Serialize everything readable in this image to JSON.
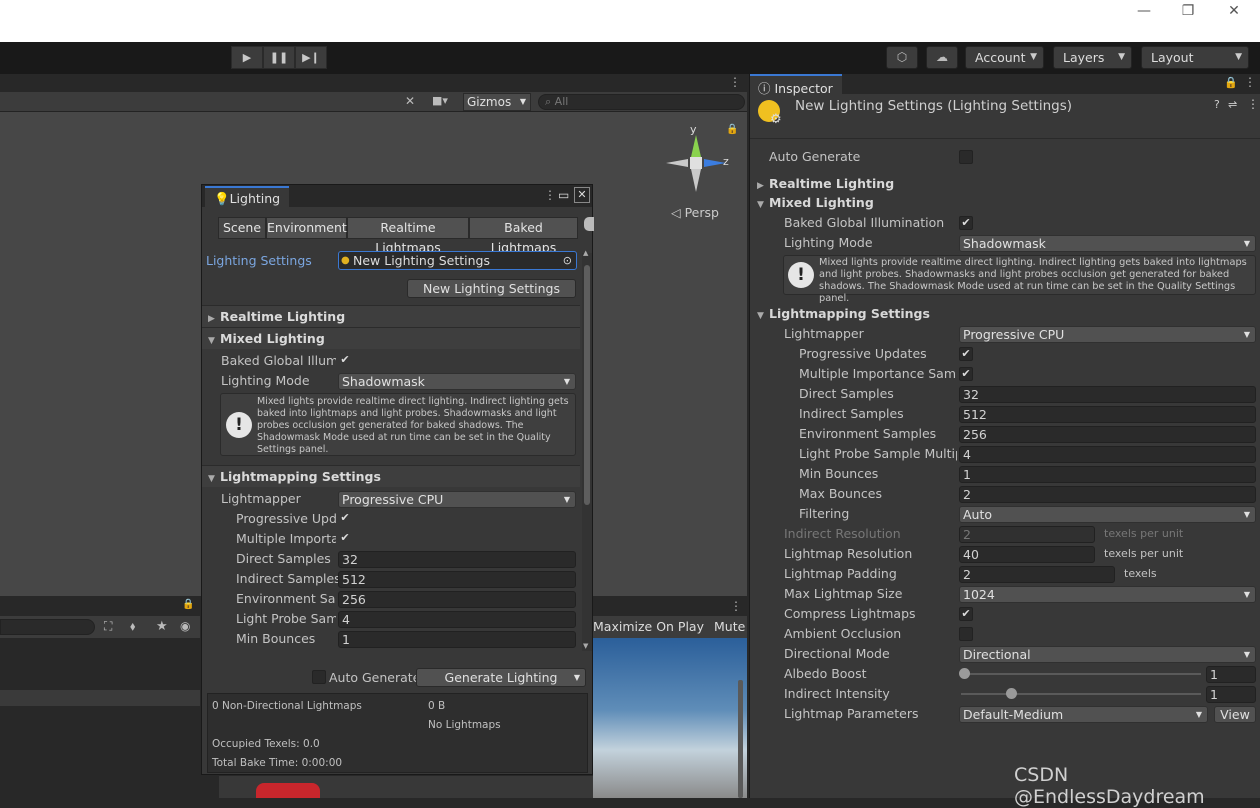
{
  "window": {
    "minimize": "—",
    "restore": "❐",
    "close": "✕"
  },
  "toolbar": {
    "account": "Account",
    "layers": "Layers",
    "layout": "Layout"
  },
  "scene": {
    "gizmos": "Gizmos",
    "search_placeholder": "All",
    "persp": "◁ Persp",
    "axis_y": "y",
    "axis_z": "z",
    "game_labels": [
      "Maximize On Play",
      "Mute Aud"
    ]
  },
  "lighting": {
    "title": "Lighting",
    "tabs": [
      "Scene",
      "Environment",
      "Realtime Lightmaps",
      "Baked Lightmaps"
    ],
    "settings_label": "Lighting Settings",
    "settings_value": "New Lighting Settings",
    "new_button": "New Lighting Settings",
    "realtime": "Realtime Lighting",
    "mixed": "Mixed Lighting",
    "baked_gi": "Baked Global Illumin",
    "lighting_mode": "Lighting Mode",
    "lighting_mode_value": "Shadowmask",
    "info": "Mixed lights provide realtime direct lighting. Indirect lighting gets baked into lightmaps and light probes. Shadowmasks and light probes occlusion get generated for baked shadows. The Shadowmask Mode used at run time can be set in the Quality Settings panel.",
    "lightmapping": "Lightmapping Settings",
    "lightmapper": "Lightmapper",
    "lightmapper_value": "Progressive CPU",
    "progressive": "Progressive Upda",
    "multiple": "Multiple Importanc",
    "direct": "Direct Samples",
    "direct_value": "32",
    "indirect": "Indirect Samples",
    "indirect_value": "512",
    "environment": "Environment Sam",
    "environment_value": "256",
    "lightprobe": "Light Probe Samp",
    "lightprobe_value": "4",
    "minbounces": "Min Bounces",
    "minbounces_value": "1",
    "auto_generate": "Auto Generate",
    "generate": "Generate Lighting",
    "stats": {
      "nondir": "0 Non-Directional Lightmaps",
      "size": "0 B",
      "none": "No Lightmaps",
      "texels": "Occupied Texels: 0.0",
      "bake": "Total Bake Time: 0:00:00"
    }
  },
  "inspector": {
    "tab": "Inspector",
    "title": "New Lighting Settings (Lighting Settings)",
    "auto_generate": "Auto Generate",
    "realtime": "Realtime Lighting",
    "mixed": "Mixed Lighting",
    "baked_gi": "Baked Global Illumination",
    "lighting_mode": "Lighting Mode",
    "lighting_mode_value": "Shadowmask",
    "info": "Mixed lights provide realtime direct lighting. Indirect lighting gets baked into lightmaps and light probes. Shadowmasks and light probes occlusion get generated for baked shadows. The Shadowmask Mode used at run time can be set in the Quality Settings panel.",
    "lightmapping": "Lightmapping Settings",
    "lightmapper": "Lightmapper",
    "lightmapper_value": "Progressive CPU",
    "progressive": "Progressive Updates",
    "multiple": "Multiple Importance Samplin",
    "direct": "Direct Samples",
    "direct_value": "32",
    "indirect": "Indirect Samples",
    "indirect_value": "512",
    "environment": "Environment Samples",
    "environment_value": "256",
    "lightprobe": "Light Probe Sample Multiplie",
    "lightprobe_value": "4",
    "minb": "Min Bounces",
    "minb_value": "1",
    "maxb": "Max Bounces",
    "maxb_value": "2",
    "filtering": "Filtering",
    "filtering_value": "Auto",
    "indres": "Indirect Resolution",
    "indres_value": "2",
    "texels_per_unit": "texels per unit",
    "lmres": "Lightmap Resolution",
    "lmres_value": "40",
    "padding": "Lightmap Padding",
    "padding_value": "2",
    "texels": "texels",
    "maxsize": "Max Lightmap Size",
    "maxsize_value": "1024",
    "compress": "Compress Lightmaps",
    "ao": "Ambient Occlusion",
    "dirmode": "Directional Mode",
    "dirmode_value": "Directional",
    "albedo": "Albedo Boost",
    "albedo_value": "1",
    "indint": "Indirect Intensity",
    "indint_value": "1",
    "params": "Lightmap Parameters",
    "params_value": "Default-Medium",
    "view": "View"
  },
  "watermark": "CSDN @EndlessDaydream"
}
